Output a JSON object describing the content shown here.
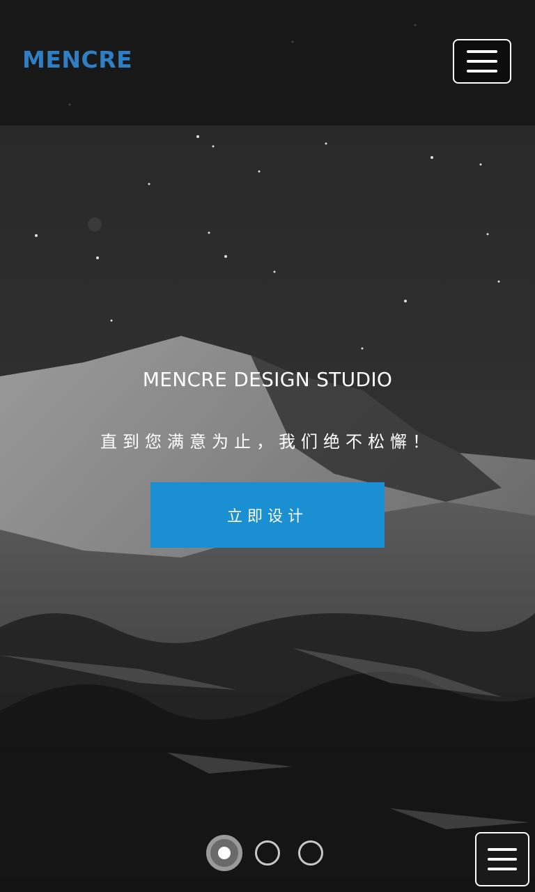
{
  "header": {
    "brand": "MENCRE",
    "menu_icon": "hamburger-menu-icon"
  },
  "hero": {
    "title": "MENCRE DESIGN STUDIO",
    "subtitle": "直到您满意为止，我们绝不松懈！",
    "cta_label": "立即设计",
    "background": "night-snowy-mountain-photo"
  },
  "carousel": {
    "slide_count": 3,
    "active_index": 0
  },
  "floating_menu": {
    "icon": "hamburger-menu-icon"
  },
  "colors": {
    "brand": "#2f7fc4",
    "cta": "#1a8fd2",
    "header_bg": "#141414"
  }
}
